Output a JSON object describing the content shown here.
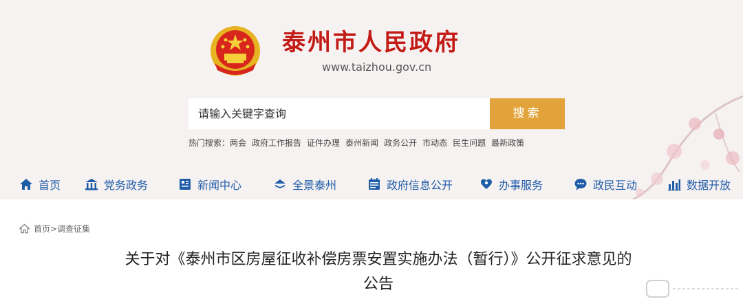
{
  "site": {
    "title": "泰州市人民政府",
    "url": "www.taizhou.gov.cn"
  },
  "search": {
    "placeholder": "请输入关键字查询",
    "button_label": "搜索"
  },
  "hot_search": {
    "label": "热门搜索：",
    "items": [
      "两会",
      "政府工作报告",
      "证件办理",
      "泰州新闻",
      "政务公开",
      "市动态",
      "民生问题",
      "最新政策"
    ]
  },
  "nav": {
    "items": [
      {
        "label": "首页",
        "icon": "home-icon"
      },
      {
        "label": "党务政务",
        "icon": "building-icon"
      },
      {
        "label": "新闻中心",
        "icon": "news-icon"
      },
      {
        "label": "全景泰州",
        "icon": "panorama-icon"
      },
      {
        "label": "政府信息公开",
        "icon": "calendar-icon"
      },
      {
        "label": "办事服务",
        "icon": "service-icon"
      },
      {
        "label": "政民互动",
        "icon": "chat-icon"
      },
      {
        "label": "数据开放",
        "icon": "bar-chart-icon"
      }
    ]
  },
  "breadcrumb": {
    "home": "首页",
    "separator": ">",
    "current": "调查征集"
  },
  "article": {
    "title_line1": "关于对《泰州市区房屋征收补偿房票安置实施办法（暂行）》公开征求意见的",
    "title_line2": "公告"
  },
  "colors": {
    "brand_red": "#c21b16",
    "nav_blue": "#1f5ca8",
    "search_orange": "#e2a33a"
  }
}
